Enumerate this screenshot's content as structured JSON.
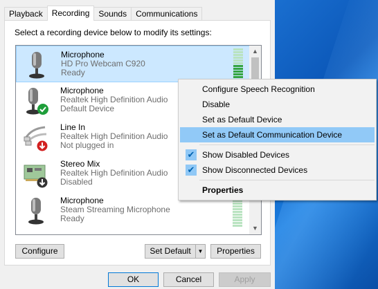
{
  "tabs": [
    {
      "label": "Playback"
    },
    {
      "label": "Recording"
    },
    {
      "label": "Sounds"
    },
    {
      "label": "Communications"
    }
  ],
  "instruction": "Select a recording device below to modify its settings:",
  "devices": [
    {
      "name": "Microphone",
      "description": "HD Pro Webcam C920",
      "status": "Ready",
      "icon": "microphone-icon",
      "meter_level": 0.5,
      "selected": true
    },
    {
      "name": "Microphone",
      "description": "Realtek High Definition Audio",
      "status": "Default Device",
      "icon": "microphone-default-icon"
    },
    {
      "name": "Line In",
      "description": "Realtek High Definition Audio",
      "status": "Not plugged in",
      "icon": "line-in-icon"
    },
    {
      "name": "Stereo Mix",
      "description": "Realtek High Definition Audio",
      "status": "Disabled",
      "icon": "sound-card-icon"
    },
    {
      "name": "Microphone",
      "description": "Steam Streaming Microphone",
      "status": "Ready",
      "icon": "microphone-icon",
      "meter_level": 0
    }
  ],
  "context_menu": {
    "items": [
      {
        "label": "Configure Speech Recognition"
      },
      {
        "label": "Disable"
      },
      {
        "label": "Set as Default Device"
      },
      {
        "label": "Set as Default Communication Device",
        "highlighted": true
      },
      {
        "label": "Show Disabled Devices",
        "checked": true
      },
      {
        "label": "Show Disconnected Devices",
        "checked": true
      },
      {
        "label": "Properties",
        "bold": true
      }
    ]
  },
  "buttons": {
    "configure": "Configure",
    "set_default": "Set Default",
    "properties": "Properties",
    "ok": "OK",
    "cancel": "Cancel",
    "apply": "Apply"
  },
  "colors": {
    "selection": "#cce8ff",
    "menu_highlight": "#91c9f7",
    "meter_on": "#35a542",
    "meter_off": "#b9e3c0",
    "desktop": "#0b57b8"
  }
}
